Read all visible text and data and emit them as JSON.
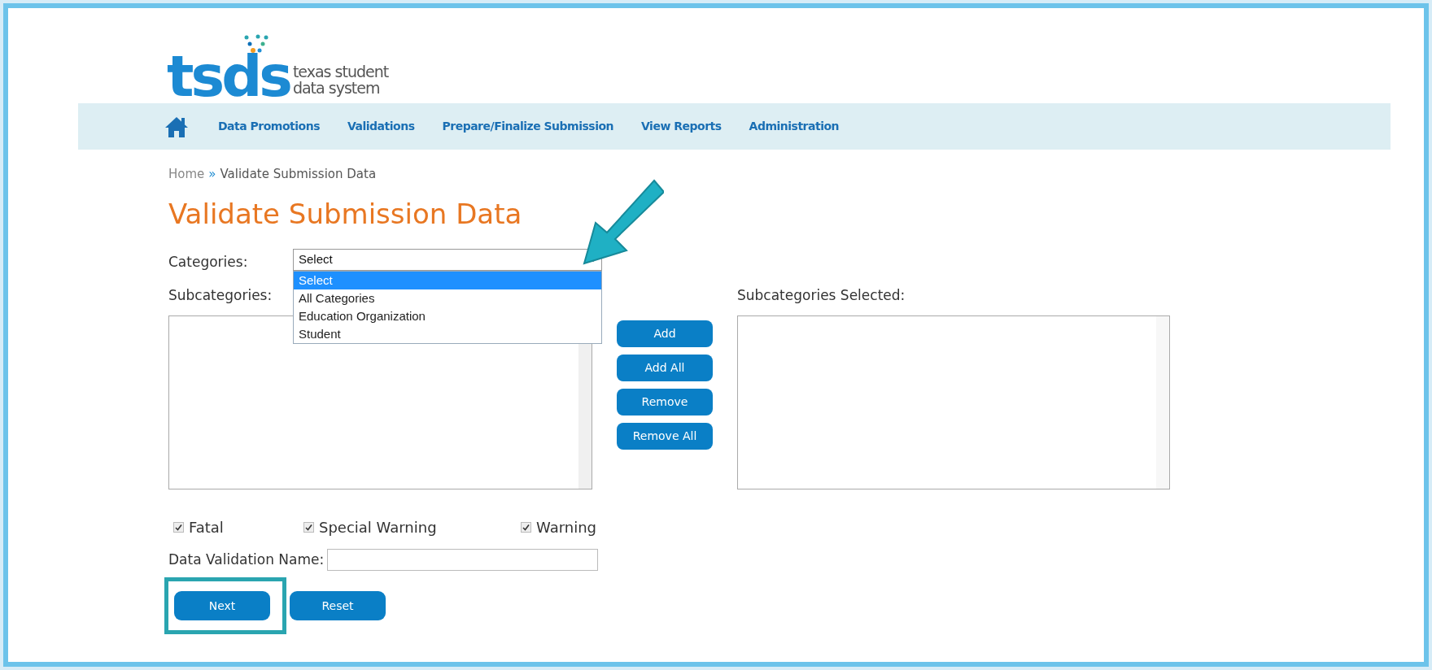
{
  "logo": {
    "mark": "tsds",
    "tagline": [
      "texas student",
      "data system"
    ]
  },
  "nav": {
    "items": [
      "Data Promotions",
      "Validations",
      "Prepare/Finalize Submission",
      "View Reports",
      "Administration"
    ]
  },
  "breadcrumb": {
    "home": "Home",
    "separator": "»",
    "current": "Validate Submission Data"
  },
  "title": "Validate Submission Data",
  "categories": {
    "label": "Categories:",
    "value": "Select",
    "expanded": true,
    "options": [
      {
        "label": "Select",
        "selected": true
      },
      {
        "label": "All Categories",
        "selected": false
      },
      {
        "label": "Education Organization",
        "selected": false
      },
      {
        "label": "Student",
        "selected": false
      }
    ]
  },
  "subcategories": {
    "label": "Subcategories:"
  },
  "selected_subcategories": {
    "label": "Subcategories Selected:"
  },
  "transfer_buttons": [
    "Add",
    "Add All",
    "Remove",
    "Remove All"
  ],
  "severity": [
    {
      "label": "Fatal",
      "checked": true
    },
    {
      "label": "Special Warning",
      "checked": true
    },
    {
      "label": "Warning",
      "checked": true
    }
  ],
  "name_field": {
    "label": "Data Validation Name:"
  },
  "buttons": [
    "Next",
    "Reset"
  ]
}
